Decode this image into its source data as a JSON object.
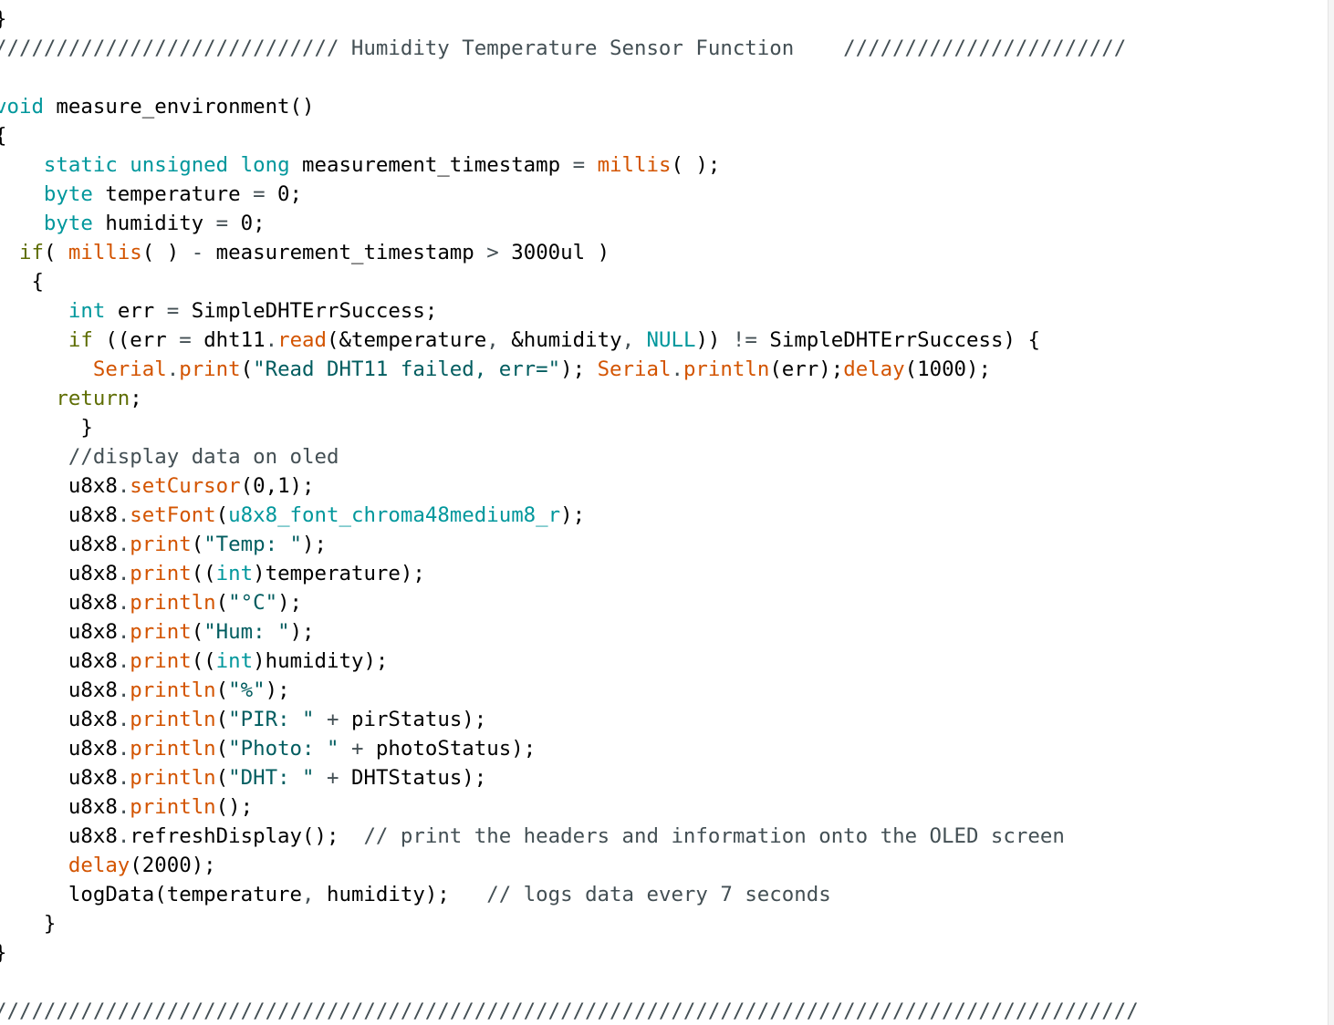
{
  "editor": {
    "language": "Arduino C++",
    "lines": [
      [
        {
          "t": "}",
          "c": ""
        }
      ],
      [
        {
          "t": "//////////////////////////// Humidity Temperature Sensor Function    ///////////////////////",
          "c": "cmt"
        }
      ],
      [],
      [
        {
          "t": "void",
          "c": "kw"
        },
        {
          "t": " measure_environment()",
          "c": ""
        }
      ],
      [
        {
          "t": "{",
          "c": ""
        }
      ],
      [
        {
          "t": "    ",
          "c": ""
        },
        {
          "t": "static",
          "c": "kw"
        },
        {
          "t": " ",
          "c": ""
        },
        {
          "t": "unsigned",
          "c": "kw"
        },
        {
          "t": " ",
          "c": ""
        },
        {
          "t": "long",
          "c": "kw"
        },
        {
          "t": " measurement_timestamp ",
          "c": ""
        },
        {
          "t": "=",
          "c": "op"
        },
        {
          "t": " ",
          "c": ""
        },
        {
          "t": "millis",
          "c": "fn"
        },
        {
          "t": "( );",
          "c": ""
        }
      ],
      [
        {
          "t": "    ",
          "c": ""
        },
        {
          "t": "byte",
          "c": "kw"
        },
        {
          "t": " temperature ",
          "c": ""
        },
        {
          "t": "=",
          "c": "op"
        },
        {
          "t": " 0;",
          "c": ""
        }
      ],
      [
        {
          "t": "    ",
          "c": ""
        },
        {
          "t": "byte",
          "c": "kw"
        },
        {
          "t": " humidity ",
          "c": ""
        },
        {
          "t": "=",
          "c": "op"
        },
        {
          "t": " 0;",
          "c": ""
        }
      ],
      [
        {
          "t": "  ",
          "c": ""
        },
        {
          "t": "if",
          "c": "ctl"
        },
        {
          "t": "( ",
          "c": ""
        },
        {
          "t": "millis",
          "c": "fn"
        },
        {
          "t": "( ) ",
          "c": ""
        },
        {
          "t": "-",
          "c": "op"
        },
        {
          "t": " measurement_timestamp ",
          "c": ""
        },
        {
          "t": ">",
          "c": "op"
        },
        {
          "t": " 3000ul )",
          "c": ""
        }
      ],
      [
        {
          "t": "   {",
          "c": ""
        }
      ],
      [
        {
          "t": "      ",
          "c": ""
        },
        {
          "t": "int",
          "c": "kw"
        },
        {
          "t": " err ",
          "c": ""
        },
        {
          "t": "=",
          "c": "op"
        },
        {
          "t": " SimpleDHTErrSuccess;",
          "c": ""
        }
      ],
      [
        {
          "t": "      ",
          "c": ""
        },
        {
          "t": "if",
          "c": "ctl"
        },
        {
          "t": " ((err ",
          "c": ""
        },
        {
          "t": "=",
          "c": "op"
        },
        {
          "t": " dht11",
          "c": ""
        },
        {
          "t": ".",
          "c": "op"
        },
        {
          "t": "read",
          "c": "fn"
        },
        {
          "t": "(&temperature",
          "c": ""
        },
        {
          "t": ",",
          "c": "op"
        },
        {
          "t": " &humidity",
          "c": ""
        },
        {
          "t": ",",
          "c": "op"
        },
        {
          "t": " ",
          "c": ""
        },
        {
          "t": "NULL",
          "c": "cst"
        },
        {
          "t": ")) ",
          "c": ""
        },
        {
          "t": "!=",
          "c": "op"
        },
        {
          "t": " SimpleDHTErrSuccess) {",
          "c": ""
        }
      ],
      [
        {
          "t": "        ",
          "c": ""
        },
        {
          "t": "Serial",
          "c": "fn"
        },
        {
          "t": ".",
          "c": "op"
        },
        {
          "t": "print",
          "c": "fn"
        },
        {
          "t": "(",
          "c": ""
        },
        {
          "t": "\"Read DHT11 failed, err=\"",
          "c": "str"
        },
        {
          "t": "); ",
          "c": ""
        },
        {
          "t": "Serial",
          "c": "fn"
        },
        {
          "t": ".",
          "c": "op"
        },
        {
          "t": "println",
          "c": "fn"
        },
        {
          "t": "(err);",
          "c": ""
        },
        {
          "t": "delay",
          "c": "fn"
        },
        {
          "t": "(1000);",
          "c": ""
        }
      ],
      [
        {
          "t": "     ",
          "c": ""
        },
        {
          "t": "return",
          "c": "ctl"
        },
        {
          "t": ";",
          "c": ""
        }
      ],
      [
        {
          "t": "       }",
          "c": ""
        }
      ],
      [
        {
          "t": "      ",
          "c": ""
        },
        {
          "t": "//display data on oled",
          "c": "cmt"
        }
      ],
      [
        {
          "t": "      u8x8",
          "c": ""
        },
        {
          "t": ".",
          "c": "op"
        },
        {
          "t": "setCursor",
          "c": "fn"
        },
        {
          "t": "(0,1);",
          "c": ""
        }
      ],
      [
        {
          "t": "      u8x8",
          "c": ""
        },
        {
          "t": ".",
          "c": "op"
        },
        {
          "t": "setFont",
          "c": "fn"
        },
        {
          "t": "(",
          "c": ""
        },
        {
          "t": "u8x8_font_chroma48medium8_r",
          "c": "kw"
        },
        {
          "t": ");",
          "c": ""
        }
      ],
      [
        {
          "t": "      u8x8",
          "c": ""
        },
        {
          "t": ".",
          "c": "op"
        },
        {
          "t": "print",
          "c": "fn"
        },
        {
          "t": "(",
          "c": ""
        },
        {
          "t": "\"Temp: \"",
          "c": "str"
        },
        {
          "t": ");",
          "c": ""
        }
      ],
      [
        {
          "t": "      u8x8",
          "c": ""
        },
        {
          "t": ".",
          "c": "op"
        },
        {
          "t": "print",
          "c": "fn"
        },
        {
          "t": "((",
          "c": ""
        },
        {
          "t": "int",
          "c": "kw"
        },
        {
          "t": ")temperature);",
          "c": ""
        }
      ],
      [
        {
          "t": "      u8x8",
          "c": ""
        },
        {
          "t": ".",
          "c": "op"
        },
        {
          "t": "println",
          "c": "fn"
        },
        {
          "t": "(",
          "c": ""
        },
        {
          "t": "\"°C\"",
          "c": "str"
        },
        {
          "t": ");",
          "c": ""
        }
      ],
      [
        {
          "t": "      u8x8",
          "c": ""
        },
        {
          "t": ".",
          "c": "op"
        },
        {
          "t": "print",
          "c": "fn"
        },
        {
          "t": "(",
          "c": ""
        },
        {
          "t": "\"Hum: \"",
          "c": "str"
        },
        {
          "t": ");",
          "c": ""
        }
      ],
      [
        {
          "t": "      u8x8",
          "c": ""
        },
        {
          "t": ".",
          "c": "op"
        },
        {
          "t": "print",
          "c": "fn"
        },
        {
          "t": "((",
          "c": ""
        },
        {
          "t": "int",
          "c": "kw"
        },
        {
          "t": ")humidity);",
          "c": ""
        }
      ],
      [
        {
          "t": "      u8x8",
          "c": ""
        },
        {
          "t": ".",
          "c": "op"
        },
        {
          "t": "println",
          "c": "fn"
        },
        {
          "t": "(",
          "c": ""
        },
        {
          "t": "\"%\"",
          "c": "str"
        },
        {
          "t": ");",
          "c": ""
        }
      ],
      [
        {
          "t": "      u8x8",
          "c": ""
        },
        {
          "t": ".",
          "c": "op"
        },
        {
          "t": "println",
          "c": "fn"
        },
        {
          "t": "(",
          "c": ""
        },
        {
          "t": "\"PIR: \"",
          "c": "str"
        },
        {
          "t": " ",
          "c": ""
        },
        {
          "t": "+",
          "c": "op"
        },
        {
          "t": " pirStatus);",
          "c": ""
        }
      ],
      [
        {
          "t": "      u8x8",
          "c": ""
        },
        {
          "t": ".",
          "c": "op"
        },
        {
          "t": "println",
          "c": "fn"
        },
        {
          "t": "(",
          "c": ""
        },
        {
          "t": "\"Photo: \"",
          "c": "str"
        },
        {
          "t": " ",
          "c": ""
        },
        {
          "t": "+",
          "c": "op"
        },
        {
          "t": " photoStatus);",
          "c": ""
        }
      ],
      [
        {
          "t": "      u8x8",
          "c": ""
        },
        {
          "t": ".",
          "c": "op"
        },
        {
          "t": "println",
          "c": "fn"
        },
        {
          "t": "(",
          "c": ""
        },
        {
          "t": "\"DHT: \"",
          "c": "str"
        },
        {
          "t": " ",
          "c": ""
        },
        {
          "t": "+",
          "c": "op"
        },
        {
          "t": " DHTStatus);",
          "c": ""
        }
      ],
      [
        {
          "t": "      u8x8",
          "c": ""
        },
        {
          "t": ".",
          "c": "op"
        },
        {
          "t": "println",
          "c": "fn"
        },
        {
          "t": "();",
          "c": ""
        }
      ],
      [
        {
          "t": "      u8x8",
          "c": ""
        },
        {
          "t": ".",
          "c": "op"
        },
        {
          "t": "refreshDisplay();  ",
          "c": ""
        },
        {
          "t": "// print the headers and information onto the OLED screen",
          "c": "cmt"
        }
      ],
      [
        {
          "t": "      ",
          "c": ""
        },
        {
          "t": "delay",
          "c": "fn"
        },
        {
          "t": "(2000);",
          "c": ""
        }
      ],
      [
        {
          "t": "      logData(temperature",
          "c": ""
        },
        {
          "t": ",",
          "c": "op"
        },
        {
          "t": " humidity);   ",
          "c": ""
        },
        {
          "t": "// logs data every 7 seconds",
          "c": "cmt"
        }
      ],
      [
        {
          "t": "    }",
          "c": ""
        }
      ],
      [
        {
          "t": "}",
          "c": ""
        }
      ],
      [],
      [
        {
          "t": "/////////////////////////////////////////////////////////////////////////////////////////////",
          "c": "cmt"
        }
      ]
    ]
  },
  "scrollbar": {
    "orientation": "vertical"
  }
}
